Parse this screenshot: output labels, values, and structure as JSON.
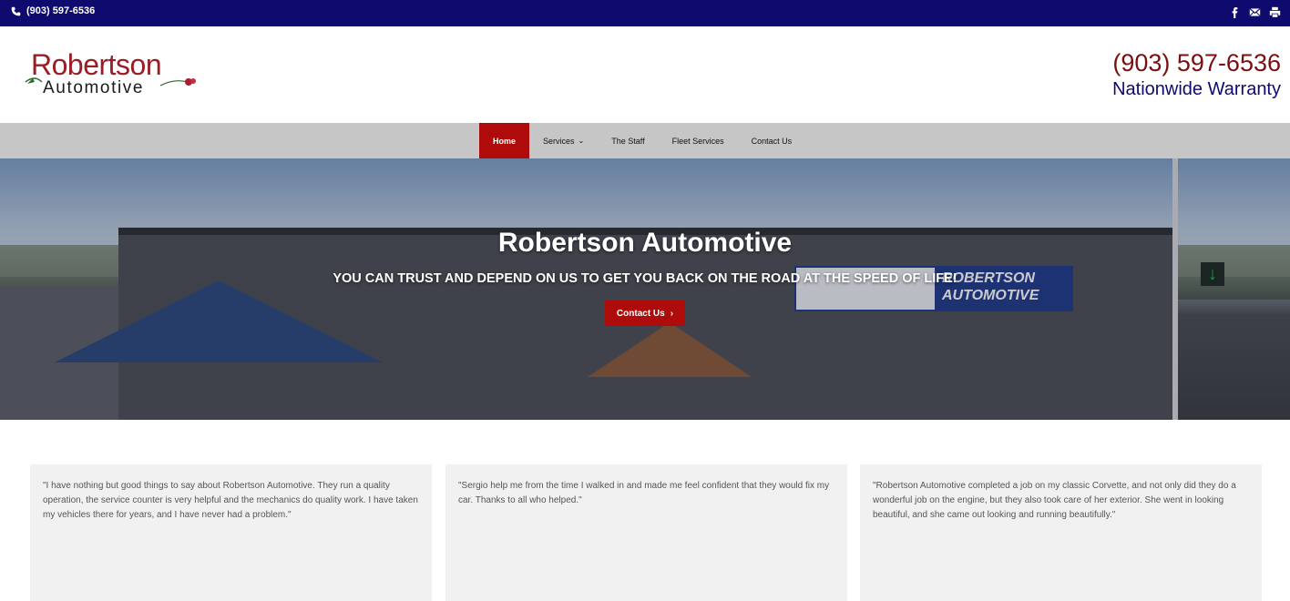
{
  "topbar": {
    "phone": "(903) 597-6536",
    "icons": [
      "phone-icon",
      "facebook-icon",
      "email-icon",
      "print-icon"
    ]
  },
  "header": {
    "logo_line1": "Robertson",
    "logo_line2": "Automotive",
    "phone": "(903) 597-6536",
    "warranty": "Nationwide Warranty"
  },
  "nav": {
    "items": [
      {
        "label": "Home",
        "active": true
      },
      {
        "label": "Services",
        "active": false
      },
      {
        "label": "The Staff",
        "active": false
      },
      {
        "label": "Fleet Services",
        "active": false
      },
      {
        "label": "Contact Us",
        "active": false
      }
    ]
  },
  "hero": {
    "title": "Robertson Automotive",
    "tagline": "YOU CAN TRUST AND DEPEND ON US TO GET YOU BACK ON THE ROAD AT THE SPEED OF LIFE!",
    "cta_label": "Contact Us",
    "sign_text_1": "ROBERTSON",
    "sign_text_2": "AUTOMOTIVE"
  },
  "testimonials": [
    "\"I have nothing but good things to say about Robertson Automotive. They run a quality operation, the service counter is very helpful and the mechanics do quality work. I have taken my vehicles there for years, and I have never had a problem.\"",
    "\"Sergio help me from the time I walked in and made me feel confident that they would fix my car. Thanks to all who helped.\"",
    "\"Robertson Automotive completed a job on my classic Corvette, and not only did they do a wonderful job on the engine, but they also took care of her exterior. She went in looking beautiful, and she came out looking and running beautifully.\""
  ],
  "colors": {
    "topbar": "#0f0a6e",
    "brand_red": "#b00b0b",
    "logo_red": "#9b1c24",
    "nav_bg": "#c6c6c6",
    "warranty_blue": "#0f0a6e"
  }
}
